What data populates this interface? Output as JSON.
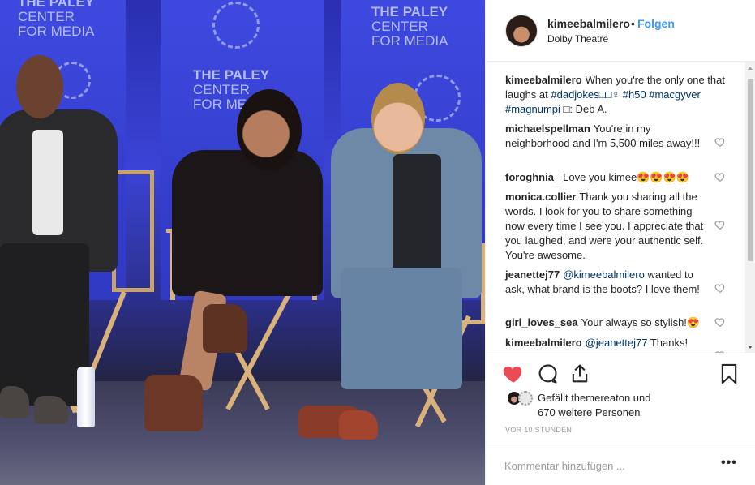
{
  "post": {
    "username": "kimeebalmilero",
    "follow_label": "Folgen",
    "separator": "•",
    "location": "Dolby Theatre"
  },
  "photo": {
    "banner_left": {
      "line1": "THE PALEY",
      "line2": "CENTER",
      "line3": "FOR MEDIA"
    },
    "banner_mid": {
      "line1": "THE PALEY",
      "line2": "CENTER",
      "line3": "FOR ME"
    },
    "banner_right": {
      "line1": "THE PALEY",
      "line2": "CENTER",
      "line3": "FOR MEDIA"
    }
  },
  "comments": [
    {
      "user": "kimeebalmilero",
      "text_before": "When you're the only one that laughs at ",
      "tags": "#dadjokes□□♀ #h50 #macgyver #magnumpi",
      "text_after": " □: Deb A."
    },
    {
      "user": "michaelspellman",
      "text": "You're in my neighborhood and I'm 5,500 miles away!!!"
    },
    {
      "user": "foroghnia_",
      "text": "Love you kimee😍😍😍😍"
    },
    {
      "user": "monica.collier",
      "text": "Thank you sharing all the words. I look for you to share something now every time I see you. I appreciate that you laughed, and were your authentic self. You're awesome."
    },
    {
      "user": "jeanettej77",
      "mention": "@kimeebalmilero",
      "text": " wanted to ask, what brand is the boots? I love them!"
    },
    {
      "user": "girl_loves_sea",
      "text": "Your always so stylish!😍"
    },
    {
      "user": "kimeebalmilero",
      "mention": "@jeanettej77",
      "text": " Thanks!"
    }
  ],
  "likes": {
    "prefix": "Gefällt ",
    "user": "themereaton",
    "middle": " und",
    "others": "670 weitere Personen"
  },
  "timestamp": "VOR 10 STUNDEN",
  "comment_input": {
    "placeholder": "Kommentar hinzufügen ..."
  },
  "more_label": "•••",
  "colors": {
    "accent": "#3897f0",
    "like_red": "#ed4956",
    "hashtag": "#003569"
  }
}
